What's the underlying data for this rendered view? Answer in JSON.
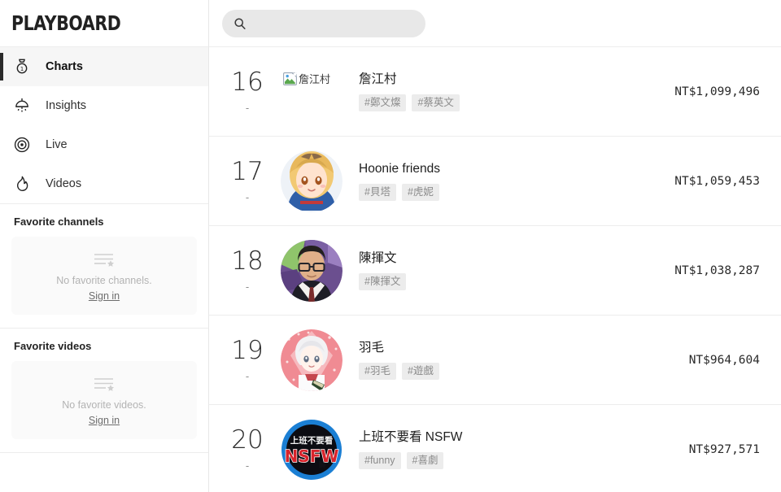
{
  "brand": {
    "name": "PLAYBOARD"
  },
  "sidebar": {
    "nav": [
      {
        "label": "Charts",
        "icon": "medal-icon",
        "active": true
      },
      {
        "label": "Insights",
        "icon": "lamp-icon",
        "active": false
      },
      {
        "label": "Live",
        "icon": "target-icon",
        "active": false
      },
      {
        "label": "Videos",
        "icon": "flame-icon",
        "active": false
      }
    ],
    "favorite_channels": {
      "title": "Favorite channels",
      "empty_text": "No favorite channels.",
      "signin_label": "Sign in",
      "empty_icon": "list-star-icon"
    },
    "favorite_videos": {
      "title": "Favorite videos",
      "empty_text": "No favorite videos.",
      "signin_label": "Sign in",
      "empty_icon": "list-star-icon"
    }
  },
  "search": {
    "icon": "search-icon",
    "value": "",
    "placeholder": ""
  },
  "chart_rows": [
    {
      "rank": "16",
      "delta": "-",
      "name": "詹江村",
      "tags": [
        "#鄭文燦",
        "#蔡英文"
      ],
      "amount": "NT$1,099,496",
      "thumb": {
        "type": "broken-image",
        "alt": "詹江村"
      }
    },
    {
      "rank": "17",
      "delta": "-",
      "name": "Hoonie friends",
      "tags": [
        "#貝塔",
        "#虎妮"
      ],
      "amount": "NT$1,059,453",
      "thumb": {
        "type": "avatar",
        "alt": "Hoonie friends",
        "style": "anime-blonde"
      }
    },
    {
      "rank": "18",
      "delta": "-",
      "name": "陳揮文",
      "tags": [
        "#陳揮文"
      ],
      "amount": "NT$1,038,287",
      "thumb": {
        "type": "avatar",
        "alt": "陳揮文",
        "style": "man-glasses"
      }
    },
    {
      "rank": "19",
      "delta": "-",
      "name": "羽毛",
      "tags": [
        "#羽毛",
        "#遊戲"
      ],
      "amount": "NT$964,604",
      "thumb": {
        "type": "avatar",
        "alt": "羽毛",
        "style": "anime-white-pink"
      }
    },
    {
      "rank": "20",
      "delta": "-",
      "name": "上班不要看 NSFW",
      "tags": [
        "#funny",
        "#喜劇"
      ],
      "amount": "NT$927,571",
      "thumb": {
        "type": "avatar",
        "alt": "上班不要看 NSFW",
        "style": "nsfw-logo"
      }
    }
  ],
  "colors": {
    "accent": "#2b2b2b",
    "tag_bg": "#ececec",
    "tag_text": "#8b8b8b",
    "search_bg": "#e8e8e8",
    "divider": "#ededed",
    "muted": "#b3b3b3"
  }
}
